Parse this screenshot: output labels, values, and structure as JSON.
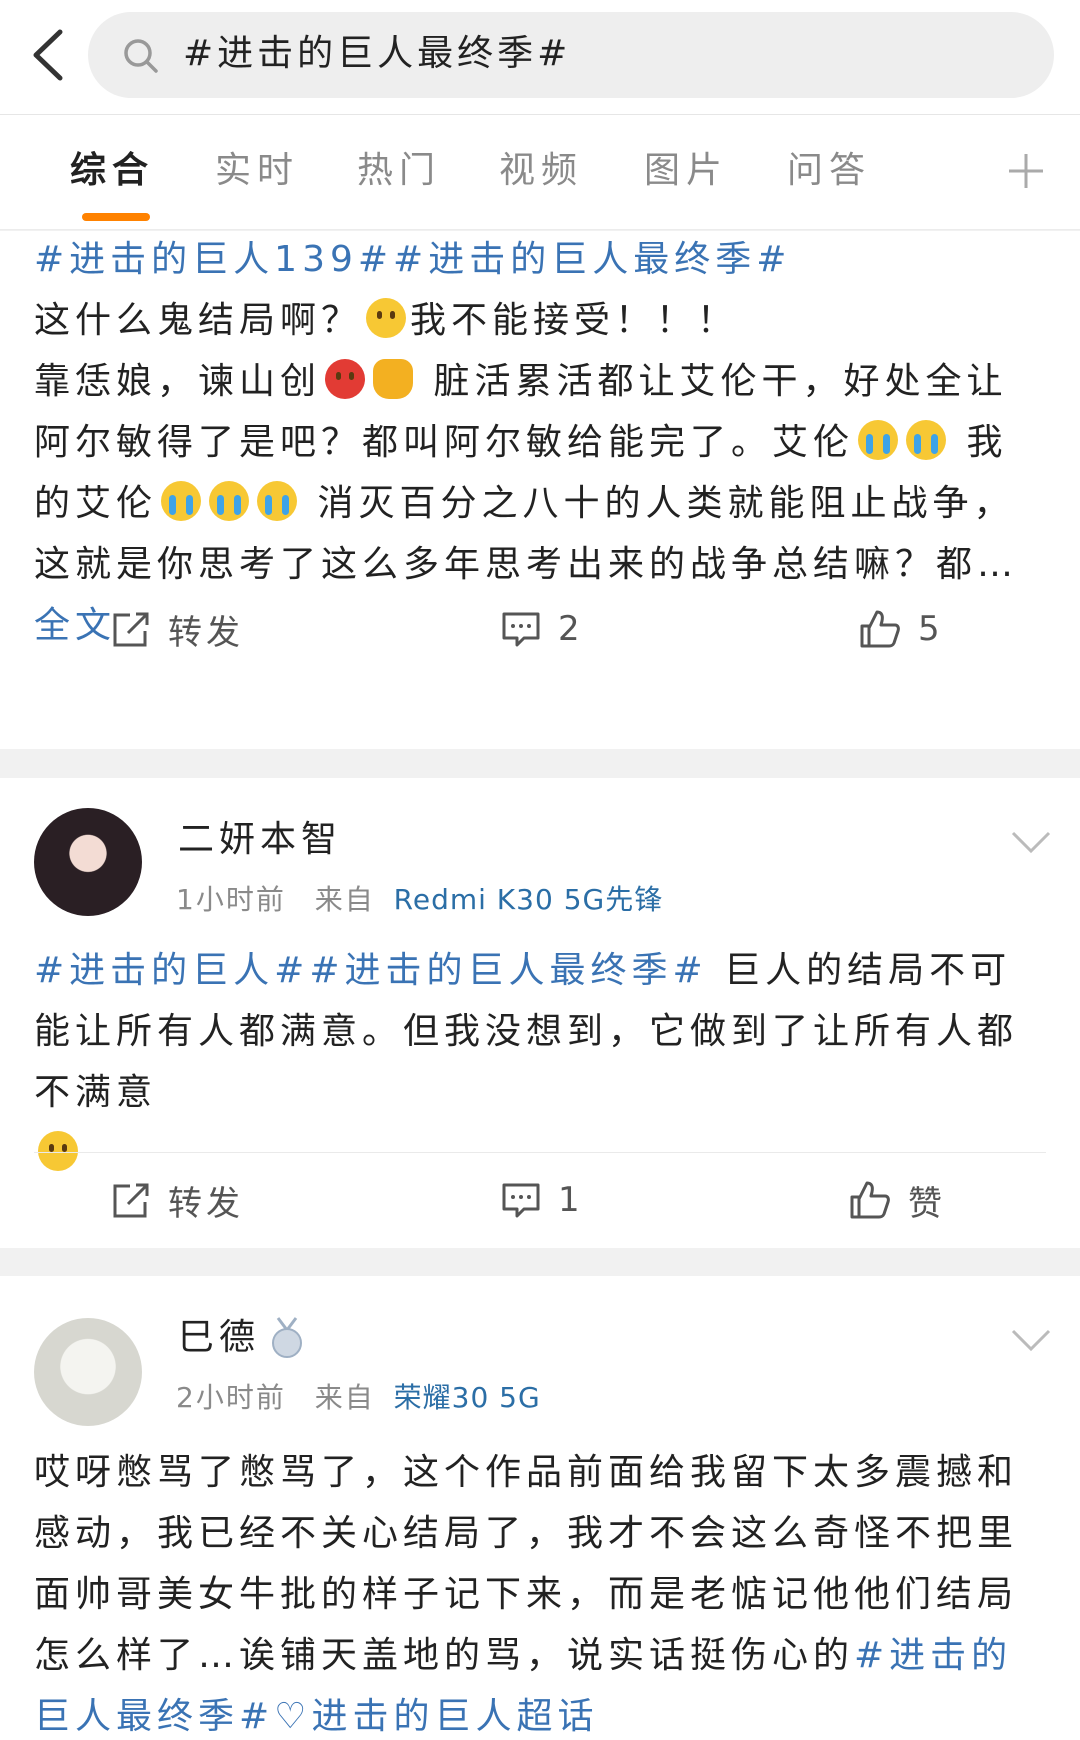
{
  "search": {
    "query": "#进击的巨人最终季#"
  },
  "tabs": [
    "综合",
    "实时",
    "热门",
    "视频",
    "图片",
    "问答"
  ],
  "posts": [
    {
      "text_parts": [
        {
          "type": "tag",
          "text": "#进击的巨人139##进击的巨人最终季#"
        },
        {
          "type": "br"
        },
        {
          "type": "text",
          "text": "这什么鬼结局啊？"
        },
        {
          "type": "emoji",
          "style": "yellow"
        },
        {
          "type": "text",
          "text": "我不能接受！！！"
        },
        {
          "type": "br"
        },
        {
          "type": "text",
          "text": "靠恁娘，谏山创"
        },
        {
          "type": "emoji",
          "style": "red"
        },
        {
          "type": "emoji",
          "style": "fist"
        },
        {
          "type": "text",
          "text": " 脏活累活都让艾伦干，好处全让阿尔敏得了是吧？都叫阿尔敏给能完了。艾伦"
        },
        {
          "type": "emoji",
          "style": "cry"
        },
        {
          "type": "emoji",
          "style": "cry"
        },
        {
          "type": "text",
          "text": " 我的艾伦"
        },
        {
          "type": "emoji",
          "style": "cry"
        },
        {
          "type": "emoji",
          "style": "cry"
        },
        {
          "type": "emoji",
          "style": "cry"
        },
        {
          "type": "text",
          "text": " 消灭百分之八十的人类就能阻止战争，这就是你思考了这么多年思考出来的战争总结嘛？都…"
        },
        {
          "type": "full",
          "text": "全文"
        }
      ],
      "actions": {
        "repost": "转发",
        "comments": "2",
        "likes": "5"
      }
    },
    {
      "username": "二妍本智",
      "time": "1小时前",
      "from_label": "来自",
      "source": "Redmi K30 5G先锋",
      "text_parts": [
        {
          "type": "tag",
          "text": "#进击的巨人##进击的巨人最终季#"
        },
        {
          "type": "text",
          "text": " 巨人的结局不可能让所有人都满意。但我没想到，它做到了让所有人都不满意"
        },
        {
          "type": "br"
        },
        {
          "type": "emoji",
          "style": "yellow"
        }
      ],
      "actions": {
        "repost": "转发",
        "comments": "1",
        "likes": "赞"
      }
    },
    {
      "username": "巳德",
      "time": "2小时前",
      "from_label": "来自",
      "source": "荣耀30 5G",
      "text_parts": [
        {
          "type": "text",
          "text": "哎呀憋骂了憋骂了，这个作品前面给我留下太多震撼和感动，我已经不关心结局了，我才不会这么奇怪不把里面帅哥美女牛批的样子记下来，而是老惦记他他们结局怎么样了…诶铺天盖地的骂，说实话挺伤心的"
        },
        {
          "type": "tag",
          "text": "#进击的巨人最终季#"
        },
        {
          "type": "tag",
          "text": "♡进击的巨人超话"
        }
      ]
    }
  ],
  "colors": {
    "accent": "#ff8200",
    "link": "#3a73b4"
  }
}
